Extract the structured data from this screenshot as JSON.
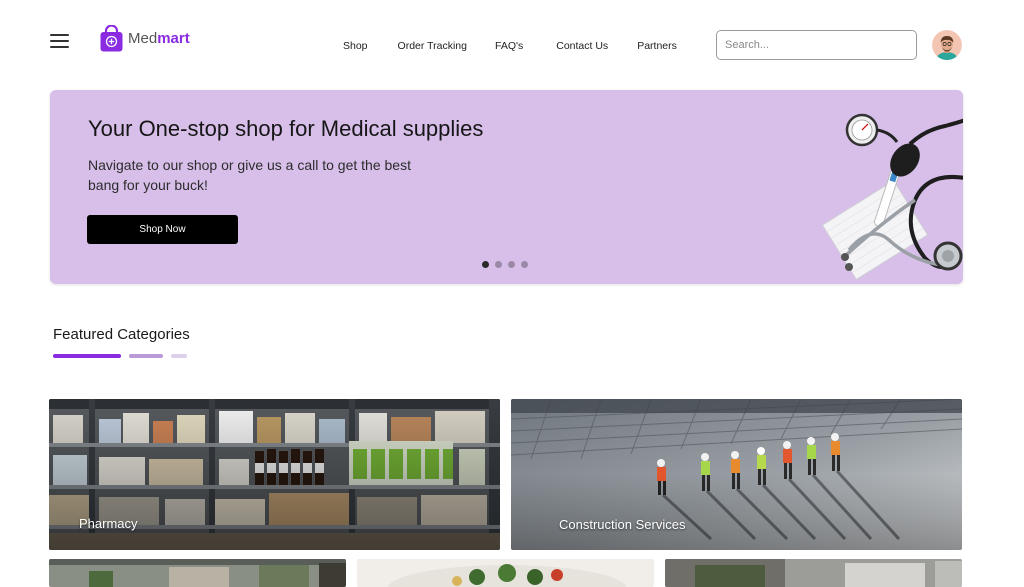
{
  "brand": {
    "name_light": "Med",
    "name_bold": "mart",
    "accent": "#8a2be2"
  },
  "nav": {
    "items": [
      "Shop",
      "Order Tracking",
      "FAQ's",
      "Contact Us",
      "Partners"
    ]
  },
  "search": {
    "placeholder": "Search..."
  },
  "hero": {
    "title": "Your One-stop shop for Medical supplies",
    "subtitle": "Navigate to our shop or give us a call to get the best bang for your buck!",
    "button_label": "Shop Now",
    "slide_count": 4,
    "active_slide": 1,
    "background": "#d8bfea"
  },
  "featured": {
    "title": "Featured Categories",
    "categories": [
      {
        "label": "Pharmacy"
      },
      {
        "label": "Construction Services"
      }
    ]
  }
}
